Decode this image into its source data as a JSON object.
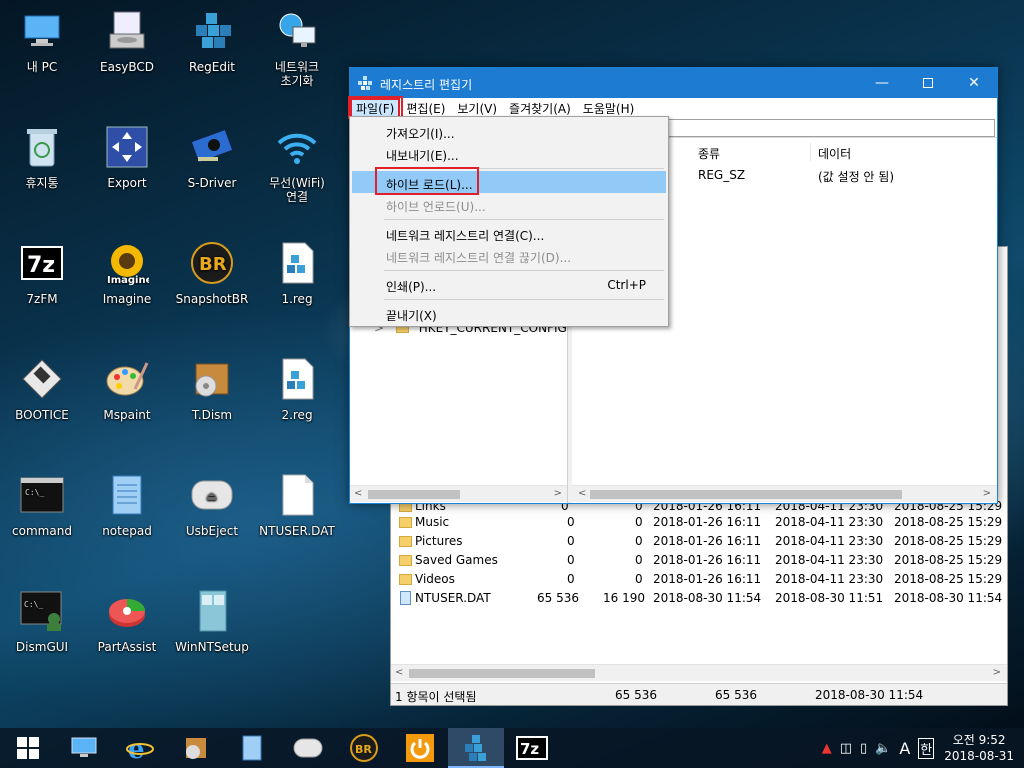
{
  "desktop_icons": [
    {
      "id": "my-pc",
      "label": "내 PC"
    },
    {
      "id": "easybcd",
      "label": "EasyBCD"
    },
    {
      "id": "regedit",
      "label": "RegEdit"
    },
    {
      "id": "network-reset",
      "label": "네트워크\n초기화"
    },
    {
      "id": "recycle-bin",
      "label": "휴지통"
    },
    {
      "id": "export",
      "label": "Export"
    },
    {
      "id": "s-driver",
      "label": "S-Driver"
    },
    {
      "id": "wifi-connect",
      "label": "무선(WiFi)\n연결"
    },
    {
      "id": "7zfm",
      "label": "7zFM"
    },
    {
      "id": "imagine",
      "label": "Imagine"
    },
    {
      "id": "snapshotbr",
      "label": "SnapshotBR"
    },
    {
      "id": "1reg",
      "label": "1.reg"
    },
    {
      "id": "bootice",
      "label": "BOOTICE"
    },
    {
      "id": "mspaint",
      "label": "Mspaint"
    },
    {
      "id": "tdism",
      "label": "T.Dism"
    },
    {
      "id": "2reg",
      "label": "2.reg"
    },
    {
      "id": "command",
      "label": "command"
    },
    {
      "id": "notepad",
      "label": "notepad"
    },
    {
      "id": "usbeject",
      "label": "UsbEject"
    },
    {
      "id": "ntuser",
      "label": "NTUSER.DAT"
    },
    {
      "id": "dismgui",
      "label": "DismGUI"
    },
    {
      "id": "partassist",
      "label": "PartAssist"
    },
    {
      "id": "winntsetup",
      "label": "WinNTSetup"
    }
  ],
  "regedit": {
    "title": "레지스트리 편집기",
    "menu": [
      "파일(F)",
      "편집(E)",
      "보기(V)",
      "즐겨찾기(A)",
      "도움말(H)"
    ],
    "tree_visible_item": "HKEY_CURRENT_CONFIG",
    "columns": [
      "종류",
      "데이터"
    ],
    "row": {
      "type": "REG_SZ",
      "data": "(값 설정 안 됨)"
    }
  },
  "file_menu": {
    "import": "가져오기(I)...",
    "export": "내보내기(E)...",
    "load_hive": "하이브 로드(L)...",
    "unload_hive": "하이브 언로드(U)...",
    "connect_network": "네트워크 레지스트리 연결(C)...",
    "disconnect_network": "네트워크 레지스트리 연결 끊기(D)...",
    "print": "인쇄(P)...",
    "print_shortcut": "Ctrl+P",
    "exit": "끝내기(X)"
  },
  "explorer": {
    "rows": [
      {
        "name": "Links",
        "size1": "0",
        "size2": "0",
        "d1": "2018-01-26 16:11",
        "d2": "2018-04-11 23:30",
        "d3": "2018-08-25 15:29",
        "kind": "folder"
      },
      {
        "name": "Music",
        "size1": "0",
        "size2": "0",
        "d1": "2018-01-26 16:11",
        "d2": "2018-04-11 23:30",
        "d3": "2018-08-25 15:29",
        "kind": "folder"
      },
      {
        "name": "Pictures",
        "size1": "0",
        "size2": "0",
        "d1": "2018-01-26 16:11",
        "d2": "2018-04-11 23:30",
        "d3": "2018-08-25 15:29",
        "kind": "folder"
      },
      {
        "name": "Saved Games",
        "size1": "0",
        "size2": "0",
        "d1": "2018-01-26 16:11",
        "d2": "2018-04-11 23:30",
        "d3": "2018-08-25 15:29",
        "kind": "folder"
      },
      {
        "name": "Videos",
        "size1": "0",
        "size2": "0",
        "d1": "2018-01-26 16:11",
        "d2": "2018-04-11 23:30",
        "d3": "2018-08-25 15:29",
        "kind": "folder"
      },
      {
        "name": "NTUSER.DAT",
        "size1": "65 536",
        "size2": "16 190",
        "d1": "2018-08-30 11:54",
        "d2": "2018-08-30 11:51",
        "d3": "2018-08-30 11:54",
        "kind": "file"
      }
    ],
    "status": {
      "selected": "1 항목이 선택됨",
      "size1": "65 536",
      "size2": "65 536",
      "date": "2018-08-30 11:54"
    }
  },
  "taskbar": {
    "tray_lang": "A",
    "tray_ime": "한",
    "clock_time": "오전 9:52",
    "clock_date": "2018-08-31"
  },
  "colors": {
    "accent": "#1d7cd1",
    "highlight": "#91c9f7",
    "annotation": "#e0202a"
  }
}
